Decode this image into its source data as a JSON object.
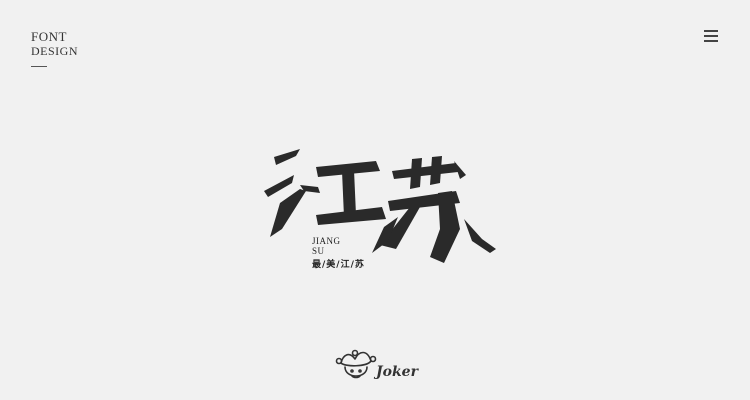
{
  "brand": {
    "line1": "Font",
    "line2": "Design"
  },
  "artwork": {
    "characters": "江苏",
    "pinyin_line1": "JIANG",
    "pinyin_line2": "SU",
    "slogan": "最/美/江/苏"
  },
  "footer": {
    "logo_text": "Joker"
  },
  "icons": {
    "menu": "hamburger-menu-icon",
    "logo": "jester-hat-icon"
  },
  "colors": {
    "background": "#f1f1f1",
    "ink": "#2a2a2a"
  }
}
